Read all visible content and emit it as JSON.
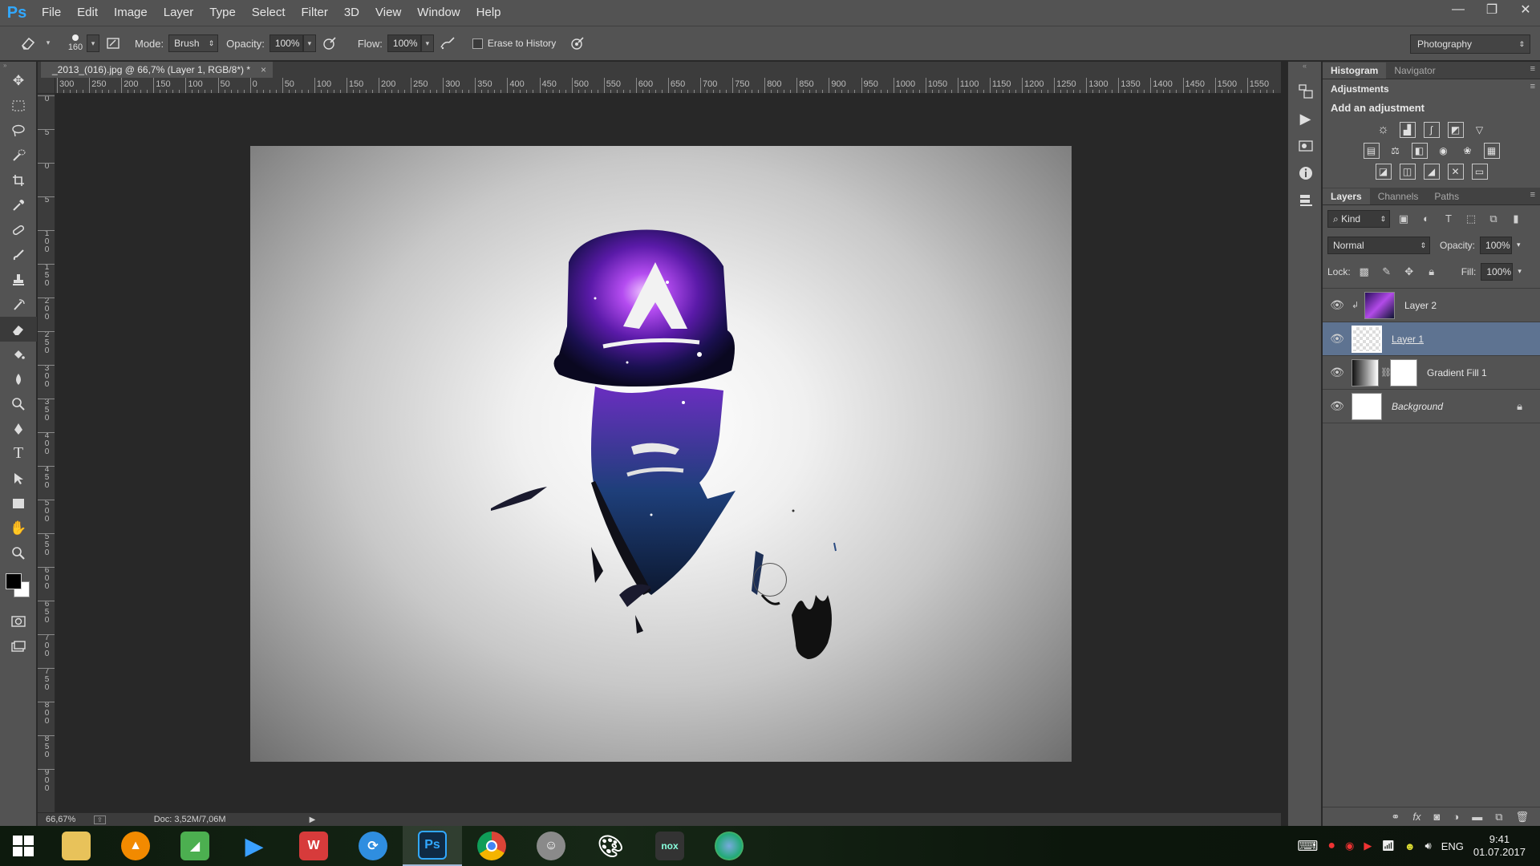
{
  "app": {
    "logo": "Ps",
    "menu": [
      "File",
      "Edit",
      "Image",
      "Layer",
      "Type",
      "Select",
      "Filter",
      "3D",
      "View",
      "Window",
      "Help"
    ],
    "window_controls": [
      "—",
      "❐",
      "✕"
    ]
  },
  "options": {
    "brush_size": "160",
    "mode_label": "Mode:",
    "mode_value": "Brush",
    "opacity_label": "Opacity:",
    "opacity_value": "100%",
    "flow_label": "Flow:",
    "flow_value": "100%",
    "erase_history_label": "Erase to History",
    "workspace": "Photography"
  },
  "document": {
    "tab_title": "_2013_(016).jpg @ 66,7% (Layer 1, RGB/8*) *",
    "tab_close": "×",
    "ruler_top": [
      "300",
      "250",
      "200",
      "150",
      "100",
      "50",
      "0",
      "50",
      "100",
      "150",
      "200",
      "250",
      "300",
      "350",
      "400",
      "450",
      "500",
      "550",
      "600",
      "650",
      "700",
      "750",
      "800",
      "850",
      "900",
      "950",
      "1000",
      "1050",
      "1100",
      "1150",
      "1200",
      "1250",
      "1300",
      "1350",
      "1400",
      "1450",
      "1500",
      "1550"
    ],
    "ruler_left": [
      "0",
      "5",
      "0",
      "5",
      "1 0 0",
      "1 5 0",
      "2 0 0",
      "2 5 0",
      "3 0 0",
      "3 5 0",
      "4 0 0",
      "4 5 0",
      "5 0 0",
      "5 5 0",
      "6 0 0",
      "6 5 0",
      "7 0 0",
      "7 5 0",
      "8 0 0",
      "8 5 0",
      "9 0 0"
    ]
  },
  "status": {
    "zoom": "66,67%",
    "doc_size": "Doc: 3,52M/7,06M"
  },
  "panels": {
    "top_tabs": [
      "Histogram",
      "Navigator"
    ],
    "adjustments_tab": "Adjustments",
    "adjustments_title": "Add an adjustment",
    "layers_tabs": [
      "Layers",
      "Channels",
      "Paths"
    ],
    "kind_label": "Kind",
    "blend_mode": "Normal",
    "opacity_label": "Opacity:",
    "opacity_value": "100%",
    "lock_label": "Lock:",
    "fill_label": "Fill:",
    "fill_value": "100%",
    "layers": [
      {
        "name": "Layer 2",
        "selected": false
      },
      {
        "name": "Layer 1",
        "selected": true
      },
      {
        "name": "Gradient Fill 1",
        "selected": false
      },
      {
        "name": "Background",
        "selected": false
      }
    ]
  },
  "taskbar": {
    "apps": [
      "file-explorer",
      "avast",
      "sketchbook",
      "media-player",
      "wps-office",
      "sync-app",
      "photoshop",
      "chrome",
      "game-app",
      "paint-app",
      "nox",
      "globe-app"
    ],
    "language": "ENG",
    "time": "9:41",
    "date": "01.07.2017"
  }
}
